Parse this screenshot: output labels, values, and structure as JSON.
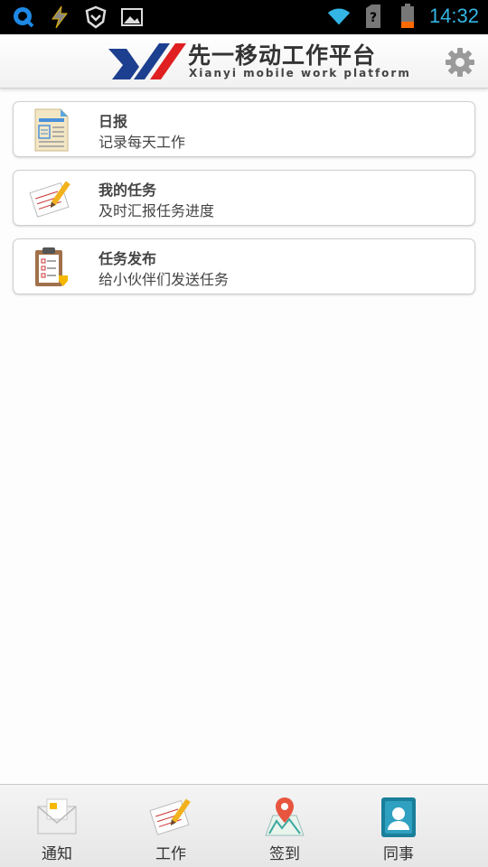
{
  "status_bar": {
    "time": "14:32",
    "accent_color": "#33b5e5",
    "left_icons": [
      "q-app-icon",
      "flash-icon",
      "shield-icon",
      "image-icon"
    ],
    "right_icons": [
      "wifi-icon",
      "sim-unknown-icon",
      "battery-icon"
    ]
  },
  "header": {
    "title_cn": "先一移动工作平台",
    "title_en": "Xianyi mobile work platform",
    "settings_icon": "gear-icon"
  },
  "menu": {
    "items": [
      {
        "title": "日报",
        "subtitle": "记录每天工作",
        "icon": "daily-report-icon"
      },
      {
        "title": "我的任务",
        "subtitle": "及时汇报任务进度",
        "icon": "my-tasks-icon"
      },
      {
        "title": "任务发布",
        "subtitle": "给小伙伴们发送任务",
        "icon": "publish-task-icon"
      }
    ]
  },
  "bottom_nav": {
    "items": [
      {
        "label": "通知",
        "icon": "notification-envelope-icon"
      },
      {
        "label": "工作",
        "icon": "work-pencil-icon"
      },
      {
        "label": "签到",
        "icon": "check-in-map-icon"
      },
      {
        "label": "同事",
        "icon": "colleagues-contact-icon"
      }
    ]
  }
}
